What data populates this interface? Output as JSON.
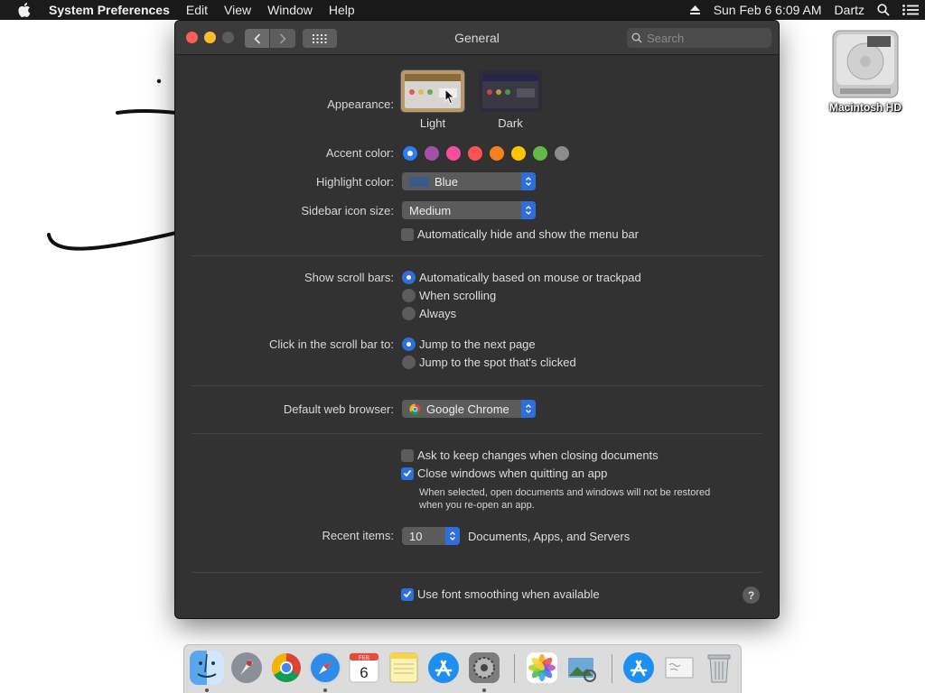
{
  "menubar": {
    "app_name": "System Preferences",
    "items": [
      "Edit",
      "View",
      "Window",
      "Help"
    ],
    "datetime": "Sun Feb 6  6:09 AM",
    "user": "Dartz"
  },
  "desktop": {
    "drive_label": "Macintosh HD"
  },
  "window": {
    "title": "General",
    "search_placeholder": "Search"
  },
  "general": {
    "appearance": {
      "label": "Appearance:",
      "options": [
        "Light",
        "Dark"
      ],
      "selected": "Light"
    },
    "accent_color": {
      "label": "Accent color:",
      "colors": [
        "#2f7cf6",
        "#a550a7",
        "#f74f9e",
        "#ff5257",
        "#f7821b",
        "#ffc600",
        "#62ba46",
        "#8c8c8c"
      ],
      "selected_index": 0
    },
    "highlight_color": {
      "label": "Highlight color:",
      "value": "Blue",
      "swatch": "#3a5a8c"
    },
    "sidebar_icon_size": {
      "label": "Sidebar icon size:",
      "value": "Medium"
    },
    "auto_hide_menubar": {
      "label": "Automatically hide and show the menu bar",
      "checked": false
    },
    "show_scroll_bars": {
      "label": "Show scroll bars:",
      "options": [
        "Automatically based on mouse or trackpad",
        "When scrolling",
        "Always"
      ],
      "selected_index": 0
    },
    "click_scroll_bar": {
      "label": "Click in the scroll bar to:",
      "options": [
        "Jump to the next page",
        "Jump to the spot that's clicked"
      ],
      "selected_index": 0
    },
    "default_browser": {
      "label": "Default web browser:",
      "value": "Google Chrome"
    },
    "ask_keep_changes": {
      "label": "Ask to keep changes when closing documents",
      "checked": false
    },
    "close_windows": {
      "label": "Close windows when quitting an app",
      "checked": true
    },
    "close_windows_note_line1": "When selected, open documents and windows will not be restored",
    "close_windows_note_line2": "when you re-open an app.",
    "recent_items": {
      "label": "Recent items:",
      "value": "10",
      "suffix": "Documents, Apps, and Servers"
    },
    "font_smoothing": {
      "label": "Use font smoothing when available",
      "checked": true
    },
    "help": "?"
  },
  "dock": {
    "items": [
      "Finder",
      "Launchpad",
      "Google Chrome",
      "Safari",
      "Calendar",
      "Notes",
      "App Store",
      "System Preferences",
      "Photos",
      "Preview",
      "Downloads",
      "Documents",
      "Trash"
    ],
    "calendar_month": "FEB",
    "calendar_day": "6"
  }
}
